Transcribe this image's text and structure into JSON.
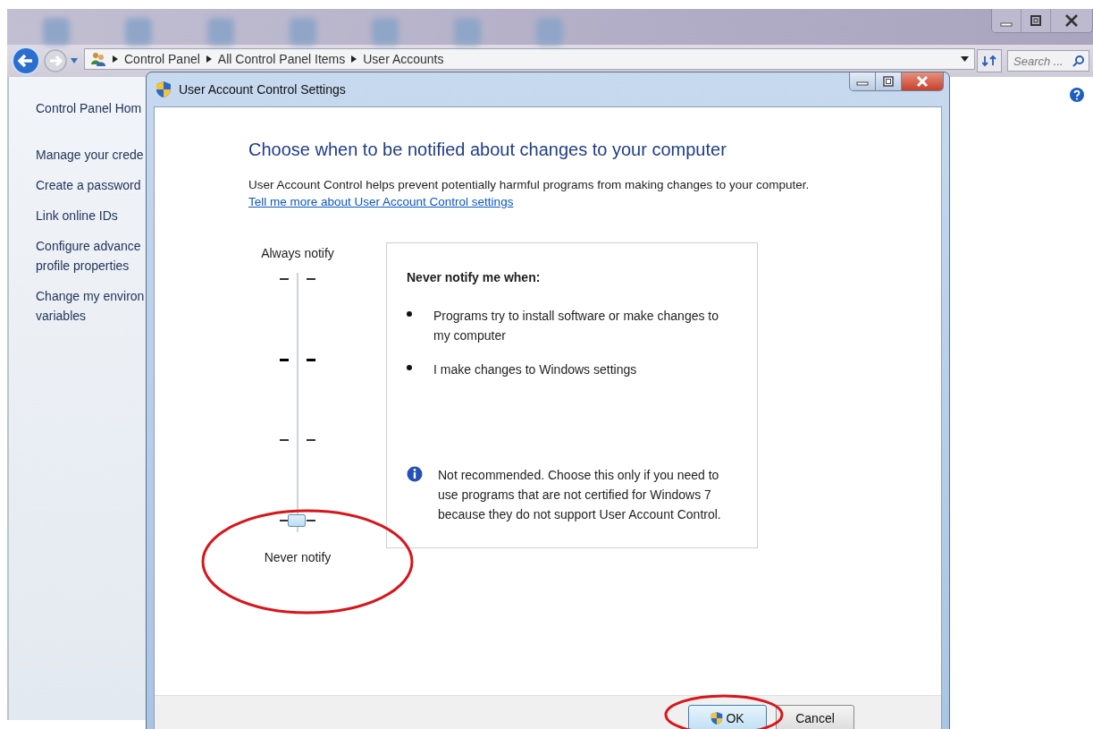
{
  "explorer": {
    "breadcrumbs": [
      "Control Panel",
      "All Control Panel Items",
      "User Accounts"
    ],
    "search": {
      "placeholder": "Search ..."
    },
    "sidebar": {
      "items": [
        {
          "lines": [
            "Control Panel Hom"
          ]
        },
        {
          "lines": [
            "Manage your crede"
          ]
        },
        {
          "lines": [
            "Create a password"
          ]
        },
        {
          "lines": [
            "Link online IDs"
          ]
        },
        {
          "lines": [
            "Configure advance",
            "profile properties"
          ]
        },
        {
          "lines": [
            "Change my environ",
            "variables"
          ]
        }
      ]
    }
  },
  "dialog": {
    "title": "User Account Control Settings",
    "heading": "Choose when to be notified about changes to your computer",
    "description": "User Account Control helps prevent potentially harmful programs from making changes to your computer.",
    "link": "Tell me more about User Account Control settings",
    "slider": {
      "top_label": "Always notify",
      "bottom_label": "Never notify",
      "level": 0
    },
    "info_panel": {
      "title": "Never notify me when:",
      "bullets": [
        "Programs try to install software or make changes to my computer",
        "I make changes to Windows settings"
      ],
      "note": "Not recommended. Choose this only if you need to use programs that are not certified for Windows 7 because they do not support User Account Control."
    },
    "buttons": [
      {
        "label": "OK",
        "kind": "shield"
      },
      {
        "label": "Cancel",
        "kind": "plain"
      }
    ]
  }
}
